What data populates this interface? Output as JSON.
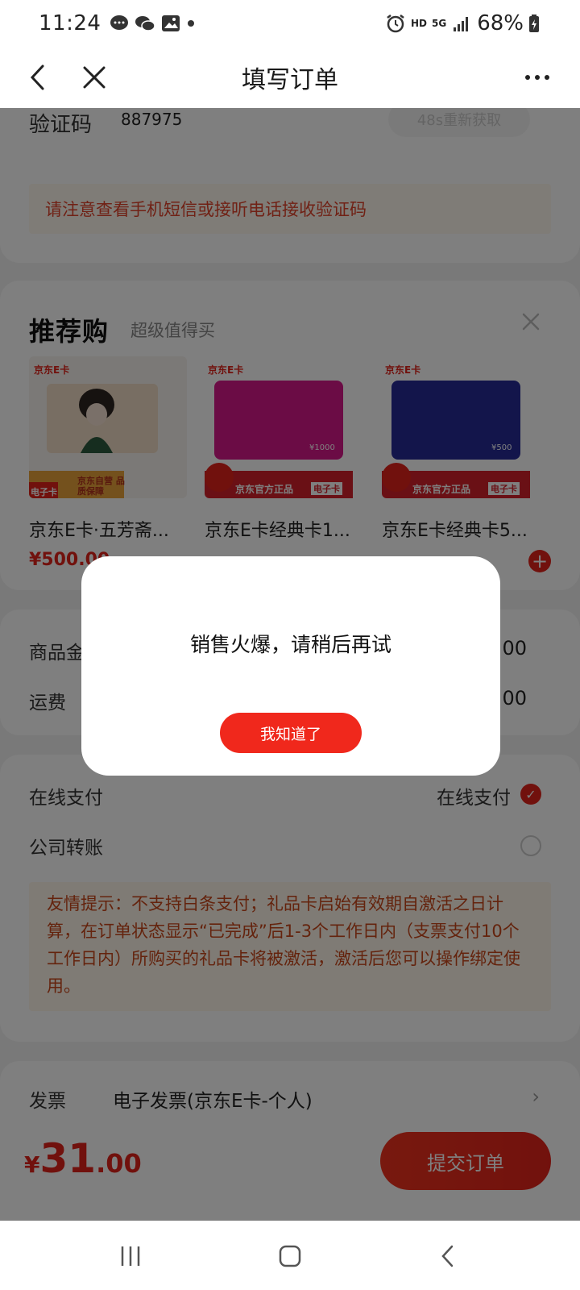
{
  "status_bar": {
    "time": "11:24",
    "hd": "HD",
    "net": "5G",
    "battery": "68%"
  },
  "nav": {
    "title": "填写订单"
  },
  "verify": {
    "label": "验证码",
    "code": "887975",
    "resend": "48s重新获取",
    "notice": "请注意查看手机短信或接听电话接收验证码"
  },
  "recommend": {
    "title": "推荐购",
    "subtitle": "超级值得买",
    "products": [
      {
        "brand": "京东E卡",
        "name": "京东E卡·五芳斋...",
        "price": "¥500.00",
        "badge": "京东自营 品质保障",
        "tag": "电子卡"
      },
      {
        "brand": "京东E卡",
        "name": "京东E卡经典卡1...",
        "face": "¥1000",
        "badge": "京东官方正品",
        "tag": "电子卡"
      },
      {
        "brand": "京东E卡",
        "name": "京东E卡经典卡5...",
        "face": "¥500",
        "badge": "京东官方正品",
        "tag": "电子卡"
      }
    ]
  },
  "summary": {
    "goods_label": "商品金",
    "goods_value": "31.00",
    "shipping_label": "运费",
    "shipping_value": "0.00"
  },
  "payment": {
    "online_label": "在线支付",
    "online_selected": "在线支付",
    "transfer_label": "公司转账",
    "tip": "友情提示：不支持白条支付；礼品卡启始有效期自激活之日计算，在订单状态显示“已完成”后1-3个工作日内（支票支付10个工作日内）所购买的礼品卡将被激活，激活后您可以操作绑定使用。"
  },
  "invoice": {
    "label": "发票",
    "value": "电子发票(京东E卡-个人)"
  },
  "bottom": {
    "currency": "¥",
    "total_int": "31",
    "total_dec": ".00",
    "submit": "提交订单"
  },
  "modal": {
    "message": "销售火爆，请稍后再试",
    "button": "我知道了"
  },
  "colors": {
    "accent": "#e2231a",
    "overlay": "rgba(0,0,0,0.5)"
  }
}
